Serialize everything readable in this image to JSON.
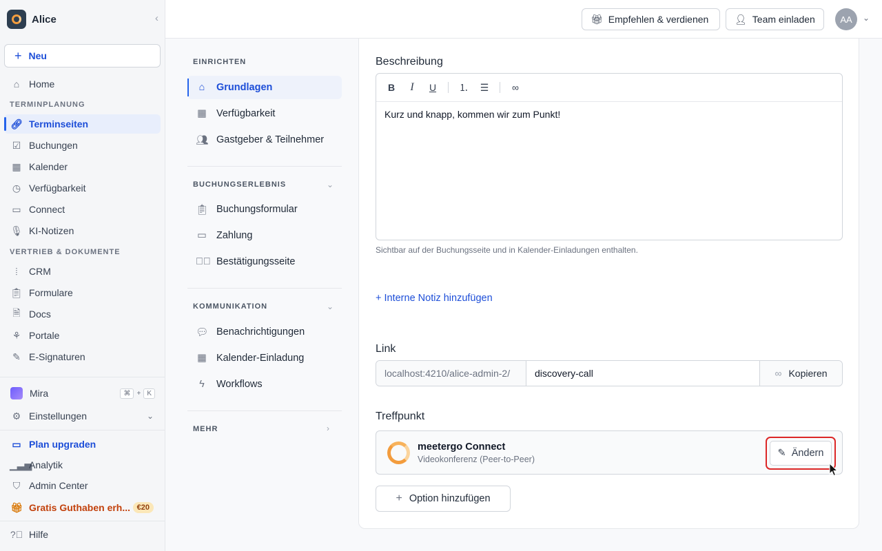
{
  "sidebar": {
    "brand": "Alice",
    "new_label": "Neu",
    "home": "Home",
    "section_termin": "TERMINPLANUNG",
    "terminseiten": "Terminseiten",
    "buchungen": "Buchungen",
    "kalender": "Kalender",
    "verfuegbarkeit": "Verfügbarkeit",
    "connect": "Connect",
    "ki_notizen": "KI-Notizen",
    "section_vertrieb": "VERTRIEB & DOKUMENTE",
    "crm": "CRM",
    "formulare": "Formulare",
    "docs": "Docs",
    "portale": "Portale",
    "e_signaturen": "E-Signaturen",
    "mira": "Mira",
    "mira_kbd_1": "⌘",
    "mira_kbd_plus": "+",
    "mira_kbd_2": "K",
    "einstellungen": "Einstellungen",
    "plan_upgraden": "Plan upgraden",
    "analytik": "Analytik",
    "admin_center": "Admin Center",
    "gratis": "Gratis Guthaben erh...",
    "gratis_badge": "€20",
    "hilfe": "Hilfe"
  },
  "topbar": {
    "recommend": "Empfehlen & verdienen",
    "invite": "Team einladen",
    "avatar": "AA"
  },
  "settings_nav": {
    "einrichten": "EINRICHTEN",
    "grundlagen": "Grundlagen",
    "verfuegbarkeit": "Verfügbarkeit",
    "gastgeber": "Gastgeber & Teilnehmer",
    "buchungserlebnis": "BUCHUNGSERLEBNIS",
    "buchungsformular": "Buchungsformular",
    "zahlung": "Zahlung",
    "bestaetigung": "Bestätigungsseite",
    "kommunikation": "KOMMUNIKATION",
    "benachrichtigungen": "Benachrichtigungen",
    "kalender_einladung": "Kalender-Einladung",
    "workflows": "Workflows",
    "mehr": "MEHR"
  },
  "main": {
    "beschreibung_label": "Beschreibung",
    "beschreibung_text": "Kurz und knapp, kommen wir zum Punkt!",
    "beschreibung_help": "Sichtbar auf der Buchungsseite und in Kalender-Einladungen enthalten.",
    "add_note": "+ Interne Notiz hinzufügen",
    "link_label": "Link",
    "link_prefix": "localhost:4210/alice-admin-2/",
    "link_slug": "discovery-call",
    "copy": "Kopieren",
    "treffpunkt_label": "Treffpunkt",
    "meet_title": "meetergo Connect",
    "meet_sub": "Videokonferenz (Peer-to-Peer)",
    "change": "Ändern",
    "add_option": "Option hinzufügen"
  },
  "colors": {
    "accent": "#1d4ed8",
    "highlight": "#dc2626",
    "brand_orange": "#f39c3d"
  }
}
